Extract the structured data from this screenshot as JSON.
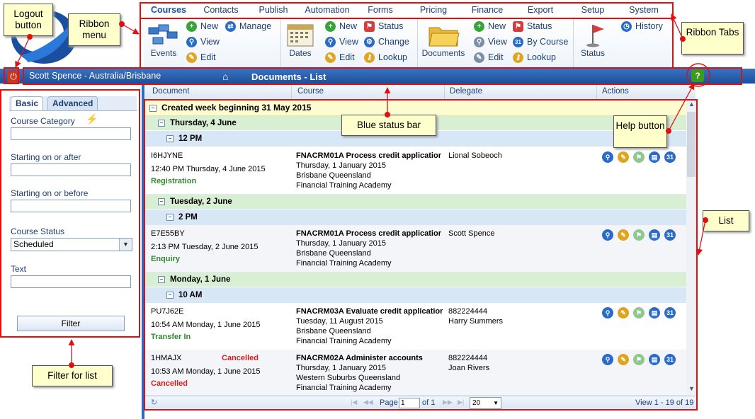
{
  "tabs": [
    "Courses",
    "Contacts",
    "Publish",
    "Automation",
    "Forms",
    "Pricing",
    "Finance",
    "Export",
    "Setup",
    "System"
  ],
  "ribbon": {
    "groups": [
      {
        "big_label": "Events",
        "items": [
          "New",
          "View",
          "Edit"
        ],
        "extra": [
          "Manage"
        ]
      },
      {
        "big_label": "Dates",
        "items": [
          "New",
          "View",
          "Edit"
        ],
        "extra": [
          "Status",
          "Change",
          "Lookup"
        ]
      },
      {
        "big_label": "Documents",
        "items": [
          "New",
          "View",
          "Edit"
        ],
        "extra": [
          "Status",
          "By Course",
          "Lookup"
        ]
      },
      {
        "big_label": "Status",
        "items": [
          "History"
        ]
      }
    ],
    "cal_badge": "31"
  },
  "status_bar": {
    "user": "Scott Spence - Australia/Brisbane",
    "title": "Documents - List",
    "help_label": "?"
  },
  "filter": {
    "tabs": [
      "Basic",
      "Advanced"
    ],
    "labels": {
      "category": "Course Category",
      "after": "Starting on or after",
      "before": "Starting on or before",
      "status": "Course Status",
      "text": "Text"
    },
    "status_value": "Scheduled",
    "button": "Filter"
  },
  "grid": {
    "columns": [
      "Document",
      "Course",
      "Delegate",
      "Actions"
    ],
    "week_group": "Created week beginning 31 May 2015",
    "day_groups": [
      "Thursday, 4 June",
      "Tuesday, 2 June",
      "Monday, 1 June"
    ],
    "time_groups": [
      "12 PM",
      "2 PM",
      "10 AM"
    ],
    "rows": [
      {
        "doc_id": "I6HJYNE",
        "created": "12:40 PM Thursday, 4 June 2015",
        "type": "Registration",
        "flag": "",
        "course": "FNACRM01A Process credit applicatior",
        "course_date": "Thursday, 1 January 2015",
        "location": "Brisbane Queensland",
        "provider": "Financial Training Academy",
        "delegate_id": "",
        "delegate": "Lional Sobeoch"
      },
      {
        "doc_id": "E7E55BY",
        "created": "2:13 PM Tuesday, 2 June 2015",
        "type": "Enquiry",
        "flag": "",
        "course": "FNACRM01A Process credit applicatior",
        "course_date": "Thursday, 1 January 2015",
        "location": "Brisbane Queensland",
        "provider": "Financial Training Academy",
        "delegate_id": "",
        "delegate": "Scott Spence"
      },
      {
        "doc_id": "PU7J62E",
        "created": "10:54 AM Monday, 1 June 2015",
        "type": "Transfer In",
        "flag": "",
        "course": "FNACRM03A Evaluate credit applicatior",
        "course_date": "Tuesday, 11 August 2015",
        "location": "Brisbane Queensland",
        "provider": "Financial Training Academy",
        "delegate_id": "882224444",
        "delegate": "Harry Summers"
      },
      {
        "doc_id": "1HMAJX",
        "created": "10:53 AM Monday, 1 June 2015",
        "type": "Cancelled",
        "flag": "Cancelled",
        "course": "FNACRM02A Administer accounts",
        "course_date": "Thursday, 1 January 2015",
        "location": "Western Suburbs Queensland",
        "provider": "Financial Training Academy",
        "delegate_id": "882224444",
        "delegate": "Joan Rivers"
      }
    ],
    "action_cal_label": "31"
  },
  "pager": {
    "page_label": "Page",
    "page_value": "1",
    "of_label": "of 1",
    "page_size": "20",
    "view_text": "View 1 - 19 of 19"
  },
  "annotations": {
    "logout": "Logout button",
    "ribbon_menu": "Ribbon menu",
    "ribbon_tabs": "Ribbon Tabs",
    "blue_status_bar": "Blue status bar",
    "help_button": "Help button",
    "list": "List",
    "filter_for_list": "Filter for list"
  },
  "colors": {
    "accent": "#2a6cc5",
    "annotation": "#e01010",
    "note_bg": "#ffffcc"
  }
}
